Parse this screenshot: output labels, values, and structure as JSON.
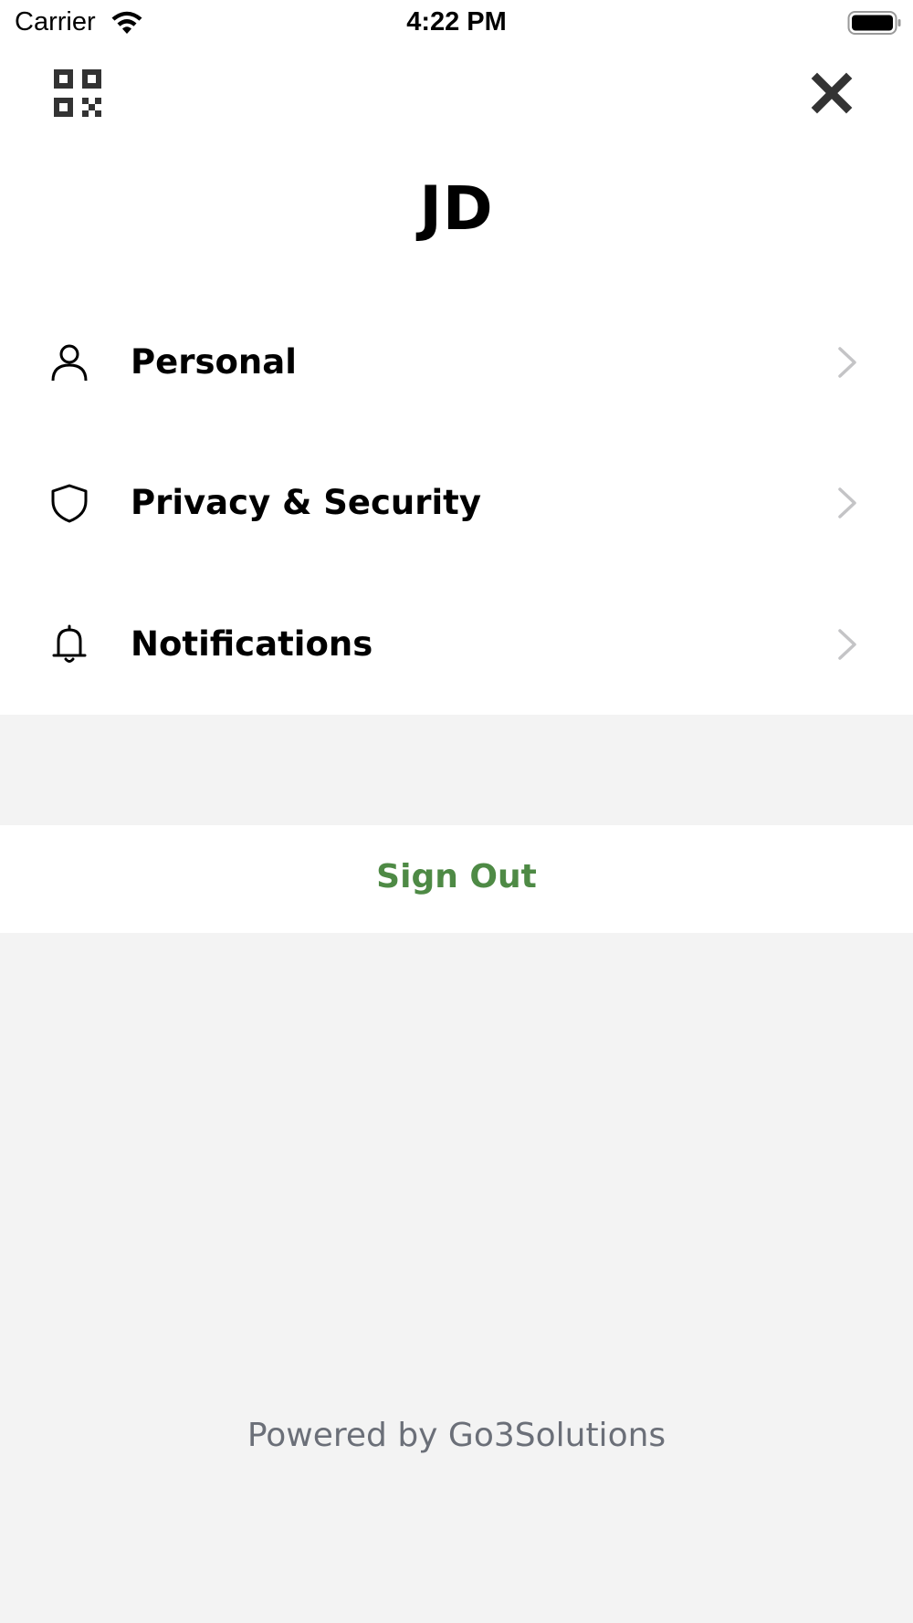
{
  "status_bar": {
    "carrier": "Carrier",
    "time": "4:22 PM",
    "wifi_icon": "wifi-icon",
    "battery_icon": "battery-icon"
  },
  "header": {
    "qr_icon": "qr-code-icon",
    "close_icon": "close-icon",
    "initials": "JD"
  },
  "menu": {
    "items": [
      {
        "label": "Personal",
        "icon": "person-icon"
      },
      {
        "label": "Privacy & Security",
        "icon": "shield-icon"
      },
      {
        "label": "Notifications",
        "icon": "bell-icon"
      }
    ]
  },
  "actions": {
    "sign_out": "Sign Out"
  },
  "footer": {
    "powered_by": "Powered by Go3Solutions"
  },
  "colors": {
    "accent_green": "#4e8a45",
    "page_background": "#f3f3f3",
    "footer_text": "#6b6f78"
  }
}
